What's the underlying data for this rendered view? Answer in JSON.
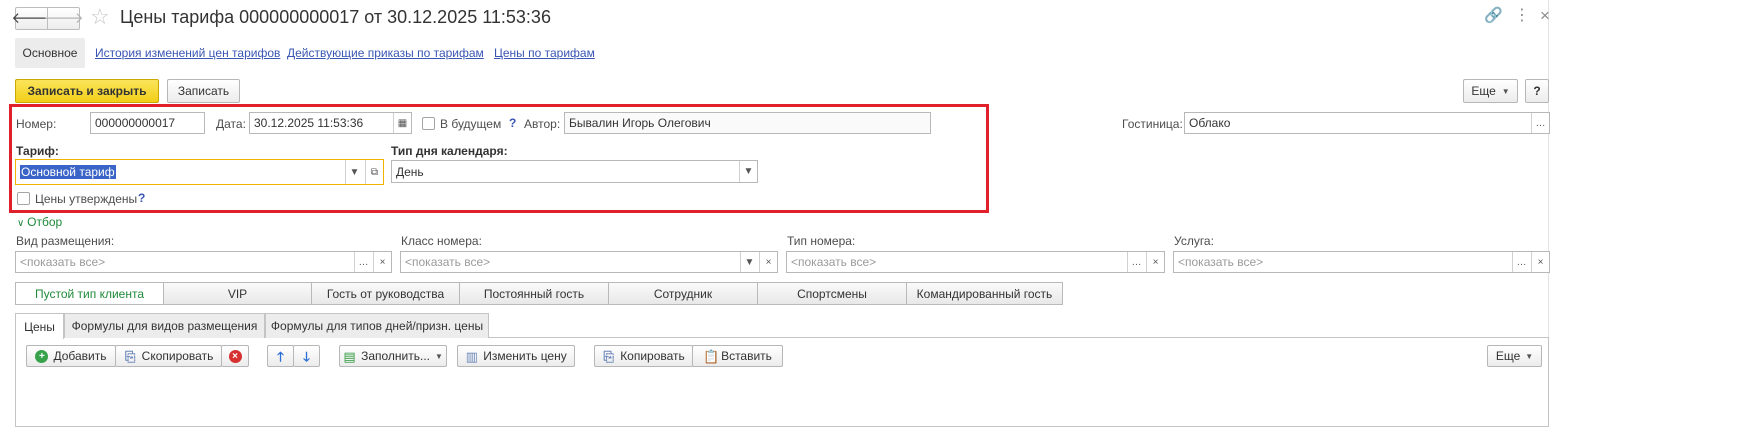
{
  "window": {
    "title": "Цены тарифа 000000000017 от 30.12.2025 11:53:36",
    "back_symbol": "🡐",
    "forward_symbol": "🡒",
    "star_symbol": "☆",
    "link_symbol": "🔗",
    "menu_symbol": "⋮",
    "close_symbol": "×"
  },
  "sections": {
    "active": "Основное",
    "links": [
      "История изменений цен тарифов",
      "Действующие приказы по тарифам",
      "Цены по тарифам"
    ]
  },
  "toolbar": {
    "save_close_label": "Записать и закрыть",
    "save_label": "Записать",
    "more_label": "Еще",
    "help_label": "?"
  },
  "header": {
    "number_label": "Номер:",
    "number_value": "000000000017",
    "date_label": "Дата:",
    "date_value": "30.12.2025 11:53:36",
    "future_label": "В будущем",
    "future_checked": false,
    "author_label": "Автор:",
    "author_value": "Бывалин Игорь Олегович",
    "hotel_label": "Гостиница:",
    "hotel_value": "Облако",
    "tariff_label": "Тариф:",
    "tariff_value": "Основной тариф",
    "day_type_label": "Тип дня календаря:",
    "day_type_value": "День",
    "prices_approved_label": "Цены утверждены",
    "prices_approved_checked": false,
    "help_mark": "?"
  },
  "filter": {
    "toggle_label": "Отбор",
    "fields": [
      {
        "label": "Вид размещения:",
        "placeholder": "<показать все>"
      },
      {
        "label": "Класс номера:",
        "placeholder": "<показать все>"
      },
      {
        "label": "Тип номера:",
        "placeholder": "<показать все>"
      },
      {
        "label": "Услуга:",
        "placeholder": "<показать все>"
      }
    ],
    "client_types": [
      "Пустой тип клиента",
      "VIP",
      "Гость от руководства",
      "Постоянный гость",
      "Сотрудник",
      "Спортсмены",
      "Командированный гость"
    ],
    "active_client_type": "Пустой тип клиента"
  },
  "tabs": {
    "items": [
      "Цены",
      "Формулы для видов размещения",
      "Формулы для типов дней/призн. цены"
    ],
    "active": "Цены"
  },
  "table_toolbar": {
    "add_label": "Добавить",
    "copy_label": "Скопировать",
    "fill_label": "Заполнить...",
    "change_price_label": "Изменить цену",
    "copy2_label": "Копировать",
    "paste_label": "Вставить",
    "more_label": "Еще"
  },
  "colors": {
    "accent_yellow": "#f5d324",
    "highlight_red": "#e0202a",
    "link_blue": "#3a56b4",
    "active_green": "#1f8a3a"
  }
}
